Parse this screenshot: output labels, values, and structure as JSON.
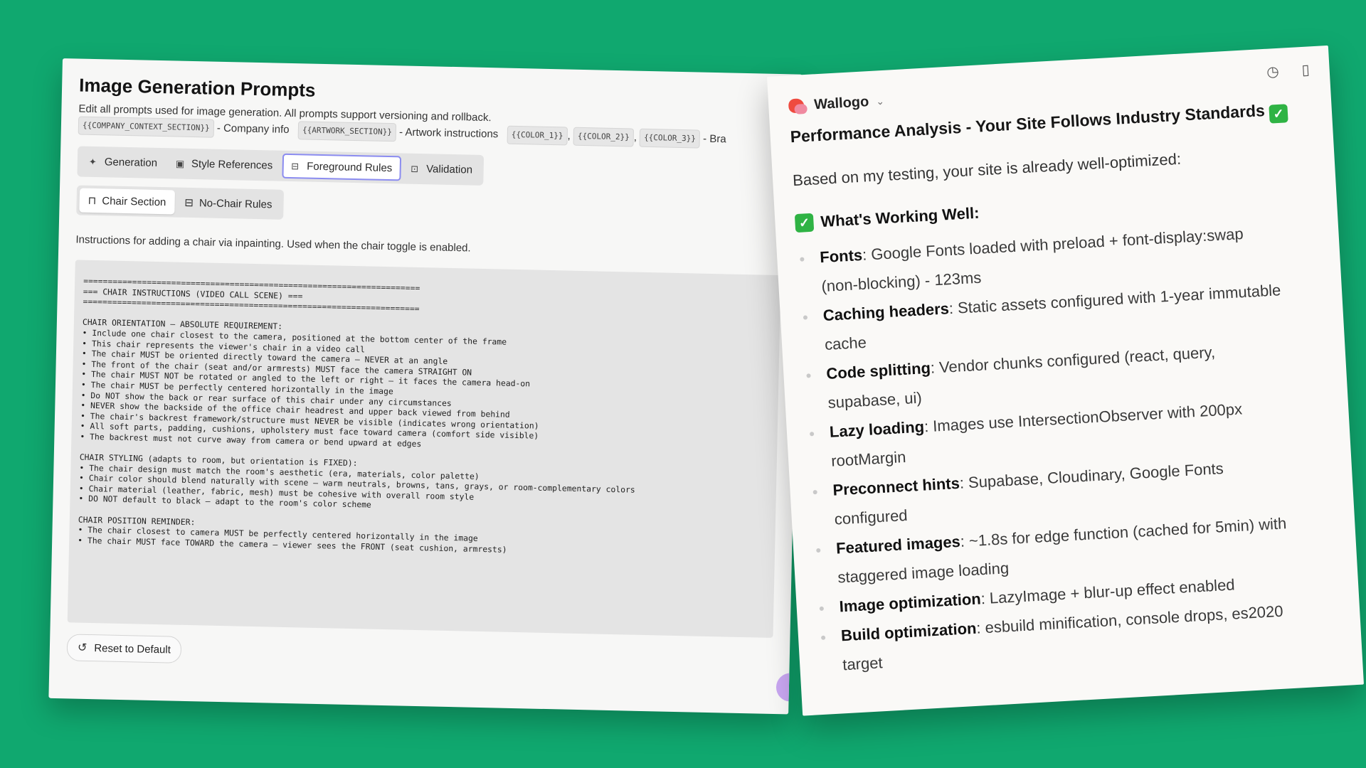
{
  "left": {
    "title": "Image Generation Prompts",
    "description": "Edit all prompts used for image generation. All prompts support versioning and rollback.",
    "vars": {
      "company_chip": "{{COMPANY_CONTEXT_SECTION}}",
      "company_text": "- Company info",
      "artwork_chip": "{{ARTWORK_SECTION}}",
      "artwork_text": "- Artwork instructions",
      "color1": "{{COLOR_1}}",
      "color2": "{{COLOR_2}}",
      "color3": "{{COLOR_3}}",
      "tail": "- Bra"
    },
    "tabs": [
      {
        "label": "Generation",
        "icon": "wand-icon"
      },
      {
        "label": "Style References",
        "icon": "image-icon"
      },
      {
        "label": "Foreground Rules",
        "icon": "layout-icon",
        "active": true
      },
      {
        "label": "Validation",
        "icon": "scan-icon"
      }
    ],
    "subtabs": [
      {
        "label": "Chair Section",
        "icon": "chair-icon",
        "active": true
      },
      {
        "label": "No-Chair Rules",
        "icon": "layout-icon"
      }
    ],
    "section_note": "Instructions for adding a chair via inpainting. Used when the chair toggle is enabled.",
    "prompt_text": "=====================================================================\n=== CHAIR INSTRUCTIONS (VIDEO CALL SCENE) ===\n=====================================================================\n\nCHAIR ORIENTATION – ABSOLUTE REQUIREMENT:\n• Include one chair closest to the camera, positioned at the bottom center of the frame\n• This chair represents the viewer's chair in a video call\n• The chair MUST be oriented directly toward the camera – NEVER at an angle\n• The front of the chair (seat and/or armrests) MUST face the camera STRAIGHT ON\n• The chair MUST NOT be rotated or angled to the left or right – it faces the camera head-on\n• The chair MUST be perfectly centered horizontally in the image\n• Do NOT show the back or rear surface of this chair under any circumstances\n• NEVER show the backside of the office chair headrest and upper back viewed from behind\n• The chair's backrest framework/structure must NEVER be visible (indicates wrong orientation)\n• All soft parts, padding, cushions, upholstery must face toward camera (comfort side visible)\n• The backrest must not curve away from camera or bend upward at edges\n\nCHAIR STYLING (adapts to room, but orientation is FIXED):\n• The chair design must match the room's aesthetic (era, materials, color palette)\n• Chair color should blend naturally with scene – warm neutrals, browns, tans, grays, or room-complementary colors\n• Chair material (leather, fabric, mesh) must be cohesive with overall room style\n• DO NOT default to black – adapt to the room's color scheme\n\nCHAIR POSITION REMINDER:\n• The chair closest to camera MUST be perfectly centered horizontally in the image\n• The chair MUST face TOWARD the camera – viewer sees the FRONT (seat cushion, armrests)",
    "reset_label": "Reset to Default"
  },
  "right": {
    "app_name": "Wallogo",
    "title": "Performance Analysis - Your Site Follows Industry Standards",
    "intro": "Based on my testing, your site is already well-optimized:",
    "section": "What's Working Well:",
    "items": [
      {
        "label": "Fonts",
        "text": ": Google Fonts loaded with preload + font-display:swap (non-blocking) - 123ms"
      },
      {
        "label": "Caching headers",
        "text": ": Static assets configured with 1-year immutable cache"
      },
      {
        "label": "Code splitting",
        "text": ": Vendor chunks configured (react, query, supabase, ui)"
      },
      {
        "label": "Lazy loading",
        "text": ": Images use IntersectionObserver with 200px rootMargin"
      },
      {
        "label": "Preconnect hints",
        "text": ": Supabase, Cloudinary, Google Fonts configured"
      },
      {
        "label": "Featured images",
        "text": ": ~1.8s for edge function (cached for 5min) with staggered image loading"
      },
      {
        "label": "Image optimization",
        "text": ": LazyImage + blur-up effect enabled"
      },
      {
        "label": "Build optimization",
        "text": ": esbuild minification, console drops, es2020 target"
      }
    ]
  },
  "colors": {
    "background": "#10a86f",
    "active_tab_border": "#8b8cf0",
    "check_green": "#2fb344"
  }
}
